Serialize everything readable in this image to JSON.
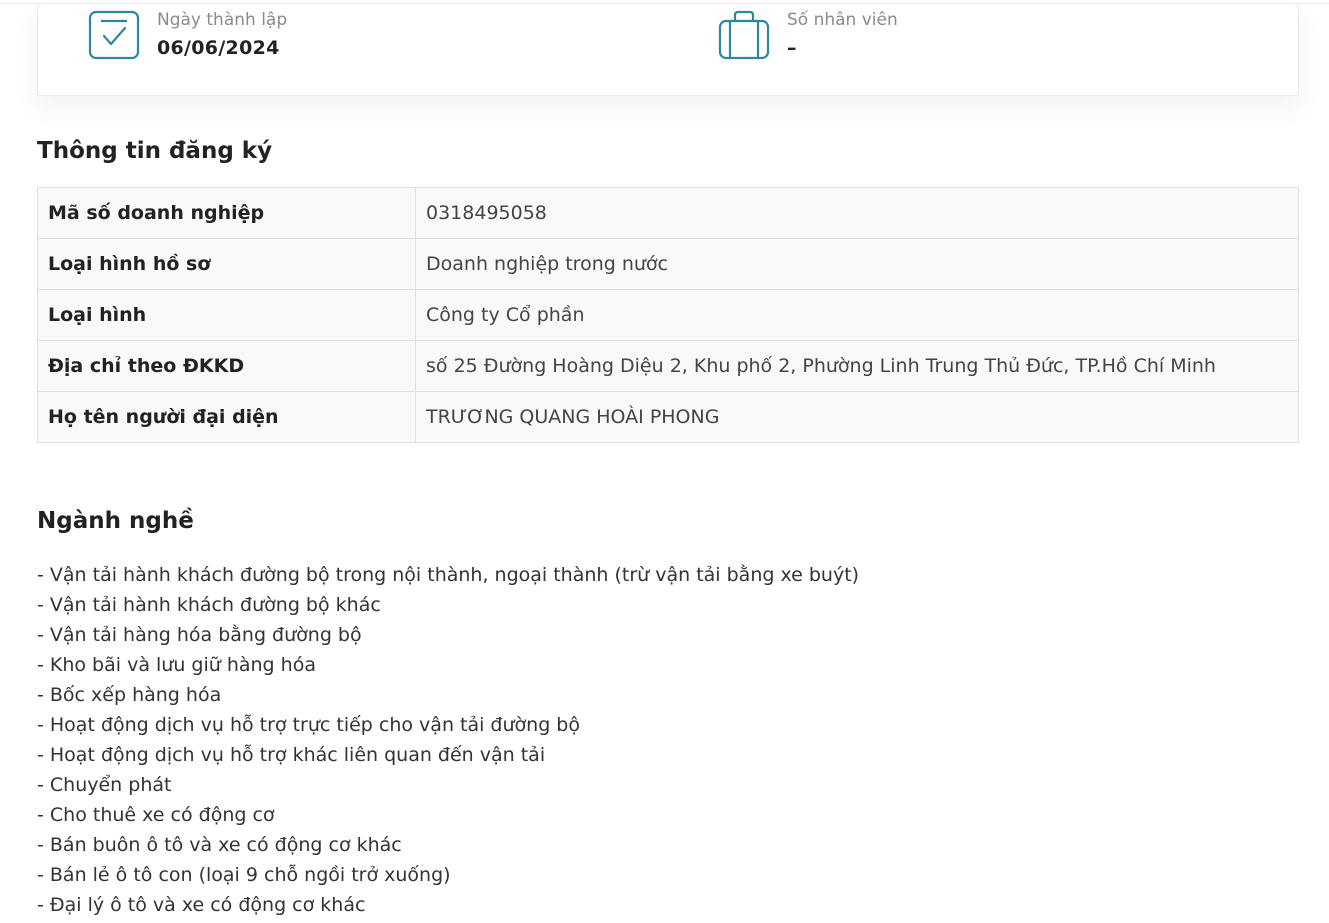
{
  "stats": {
    "founded": {
      "label": "Ngày thành lập",
      "value": "06/06/2024",
      "icon": "calendar-check-icon"
    },
    "employees": {
      "label": "Số nhân viên",
      "value": "–",
      "icon": "briefcase-icon"
    },
    "icon_color": "#2a8a9a"
  },
  "registration": {
    "title": "Thông tin đăng ký",
    "rows": [
      {
        "key": "Mã số doanh nghiệp",
        "value": "0318495058"
      },
      {
        "key": "Loại hình hồ sơ",
        "value": "Doanh nghiệp trong nước"
      },
      {
        "key": "Loại hình",
        "value": "Công ty Cổ phần"
      },
      {
        "key": "Địa chỉ theo ĐKKD",
        "value": "số 25 Đường Hoàng Diệu 2, Khu phố 2, Phường Linh Trung Thủ Đức, TP.Hồ Chí Minh"
      },
      {
        "key": "Họ tên người đại diện",
        "value": "TRƯƠNG QUANG HOÀI PHONG"
      }
    ]
  },
  "industries": {
    "title": "Ngành nghề",
    "items": [
      "- Vận tải hành khách đường bộ trong nội thành, ngoại thành (trừ vận tải bằng xe buýt)",
      "- Vận tải hành khách đường bộ khác",
      "- Vận tải hàng hóa bằng đường bộ",
      "- Kho bãi và lưu giữ hàng hóa",
      "- Bốc xếp hàng hóa",
      "- Hoạt động dịch vụ hỗ trợ trực tiếp cho vận tải đường bộ",
      "- Hoạt động dịch vụ hỗ trợ khác liên quan đến vận tải",
      "- Chuyển phát",
      "- Cho thuê xe có động cơ",
      "- Bán buôn ô tô và xe có động cơ khác",
      "- Bán lẻ ô tô con (loại 9 chỗ ngồi trở xuống)",
      "- Đại lý ô tô và xe có động cơ khác"
    ]
  }
}
